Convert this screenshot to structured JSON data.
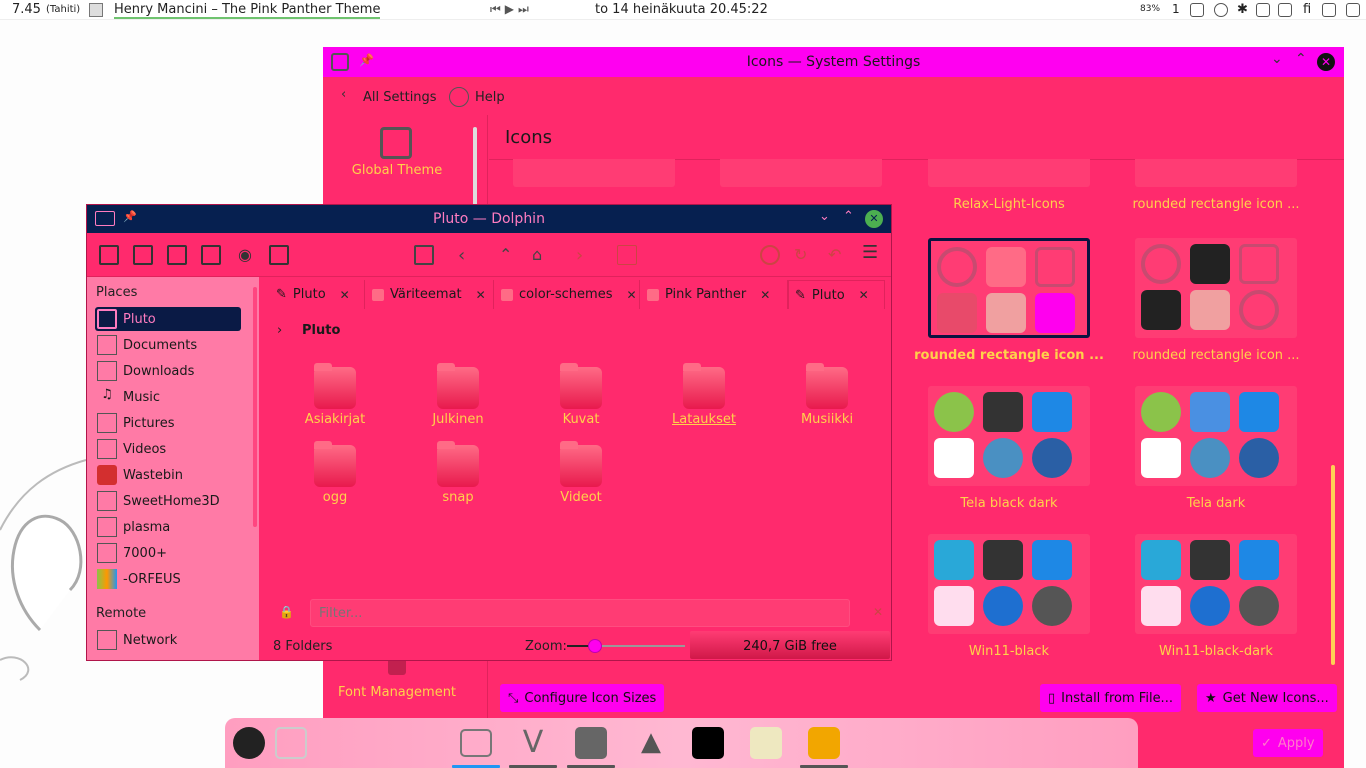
{
  "top_panel": {
    "time_left": "7.45",
    "tz": "(Tahiti)",
    "song": "Henry Mancini – The Pink Panther Theme",
    "clock": "to 14 heinäkuuta 20.45:22",
    "battery": "83%",
    "notif_count": "1",
    "lang": "fi"
  },
  "settings": {
    "title": "Icons — System Settings",
    "back_label": "All Settings",
    "help_label": "Help",
    "page_title": "Icons",
    "sidebar": [
      "Global Theme",
      "Font Management"
    ],
    "themes": [
      {
        "label": "Relax-Light-Icons"
      },
      {
        "label": "rounded rectangle icon ..."
      },
      {
        "label": "rounded rectangle icon ..."
      },
      {
        "label": "rounded rectangle icon ..."
      },
      {
        "label": "Tela black dark"
      },
      {
        "label": "Tela dark"
      },
      {
        "label": "Win11-black"
      },
      {
        "label": "Win11-black-dark"
      }
    ],
    "configure_label": "Configure Icon Sizes",
    "install_label": "Install from File...",
    "getnew_label": "Get New Icons...",
    "apply_label": "Apply"
  },
  "dolphin": {
    "title": "Pluto — Dolphin",
    "places_header": "Places",
    "places": [
      "Pluto",
      "Documents",
      "Downloads",
      "Music",
      "Pictures",
      "Videos",
      "Wastebin",
      "SweetHome3D",
      "plasma",
      "7000+",
      "-ORFEUS"
    ],
    "remote_header": "Remote",
    "remote": [
      "Network"
    ],
    "tabs": [
      "Pluto",
      "Väriteemat",
      "color-schemes",
      "Pink Panther",
      "Pluto"
    ],
    "breadcrumb": "Pluto",
    "folders": [
      "Asiakirjat",
      "Julkinen",
      "Kuvat",
      "Lataukset",
      "Musiikki",
      "ogg",
      "snap",
      "Videot"
    ],
    "filter_placeholder": "Filter...",
    "status_count": "8 Folders",
    "zoom_label": "Zoom:",
    "free_space": "240,7 GiB free",
    "zoom_level": 0.24
  },
  "colors": {
    "window_bg": "#ff2a6d",
    "titlebar": "#ff00f0",
    "dolphin_title": "#062050",
    "label": "#ffd24a"
  }
}
